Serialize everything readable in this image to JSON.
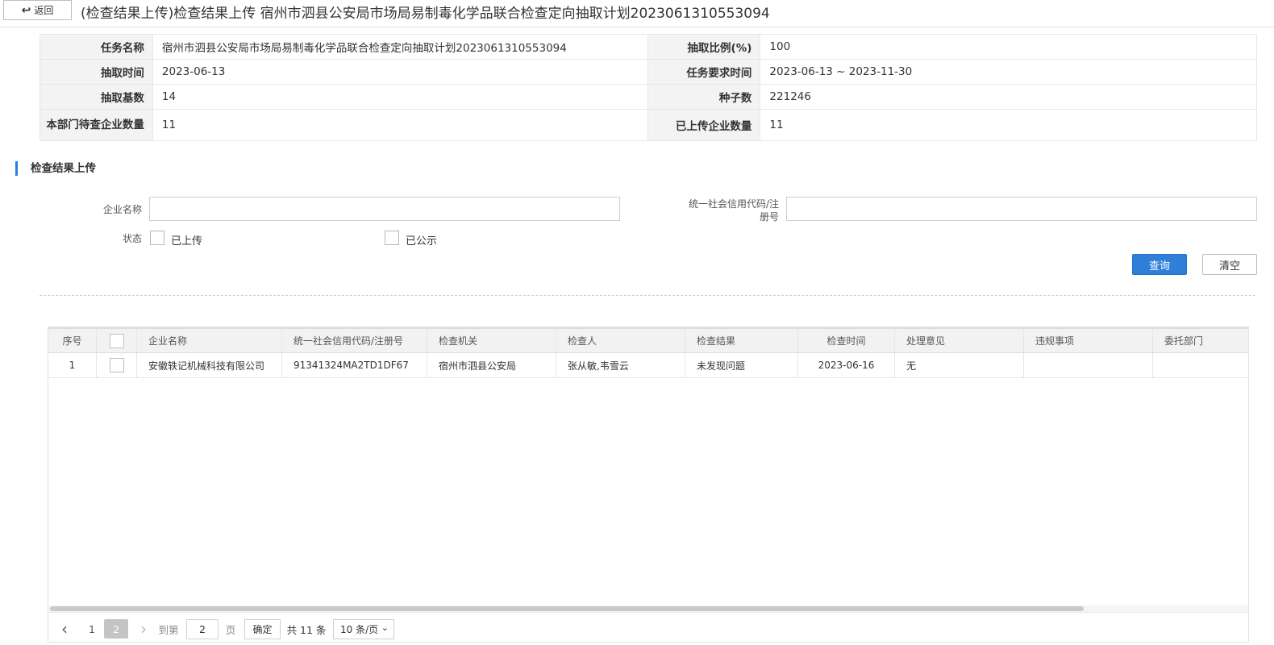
{
  "header": {
    "back_label": "返回",
    "title": "(检查结果上传)检查结果上传 宿州市泗县公安局市场局易制毒化学品联合检查定向抽取计划2023061310553094"
  },
  "info": {
    "rows": [
      {
        "label1": "任务名称",
        "value1": "宿州市泗县公安局市场局易制毒化学品联合检查定向抽取计划2023061310553094",
        "label2": "抽取比例(%)",
        "value2": "100"
      },
      {
        "label1": "抽取时间",
        "value1": "2023-06-13",
        "label2": "任务要求时间",
        "value2": "2023-06-13 ~ 2023-11-30"
      },
      {
        "label1": "抽取基数",
        "value1": "14",
        "label2": "种子数",
        "value2": "221246"
      },
      {
        "label1": "本部门待查企业数量",
        "value1": "11",
        "label2": "已上传企业数量",
        "value2": "11"
      }
    ]
  },
  "section": {
    "title": "检查结果上传"
  },
  "form": {
    "company_label": "企业名称",
    "company_value": "",
    "credit_label_line1": "统一社会信用代码/注",
    "credit_label_line2": "册号",
    "credit_value": "",
    "status_label": "状态",
    "opt_uploaded": "已上传",
    "opt_published": "已公示",
    "search_label": "查询",
    "clear_label": "清空"
  },
  "grid": {
    "columns": [
      "序号",
      "",
      "企业名称",
      "统一社会信用代码/注册号",
      "检查机关",
      "检查人",
      "检查结果",
      "检查时间",
      "处理意见",
      "违规事项",
      "委托部门"
    ],
    "rows": [
      {
        "seq": "1",
        "company": "安徽轶记机械科技有限公司",
        "credit_code": "91341324MA2TD1DF67",
        "authority": "宿州市泗县公安局",
        "inspector": "张从敏,韦雪云",
        "result": "未发现问题",
        "date": "2023-06-16",
        "opinion": "无",
        "violation": "",
        "delegate": ""
      }
    ]
  },
  "pagination": {
    "prev": "‹",
    "pages": [
      "1",
      "2"
    ],
    "current_page": "2",
    "next": "›",
    "goto_label": "到第",
    "goto_value": "2",
    "page_unit": "页",
    "confirm_label": "确定",
    "total_label": "共 11 条",
    "page_size_label": "10 条/页"
  },
  "colors": {
    "primary": "#2f7fd8",
    "section_accent": "#2a7de1",
    "label_bg": "#f3f3f3"
  }
}
